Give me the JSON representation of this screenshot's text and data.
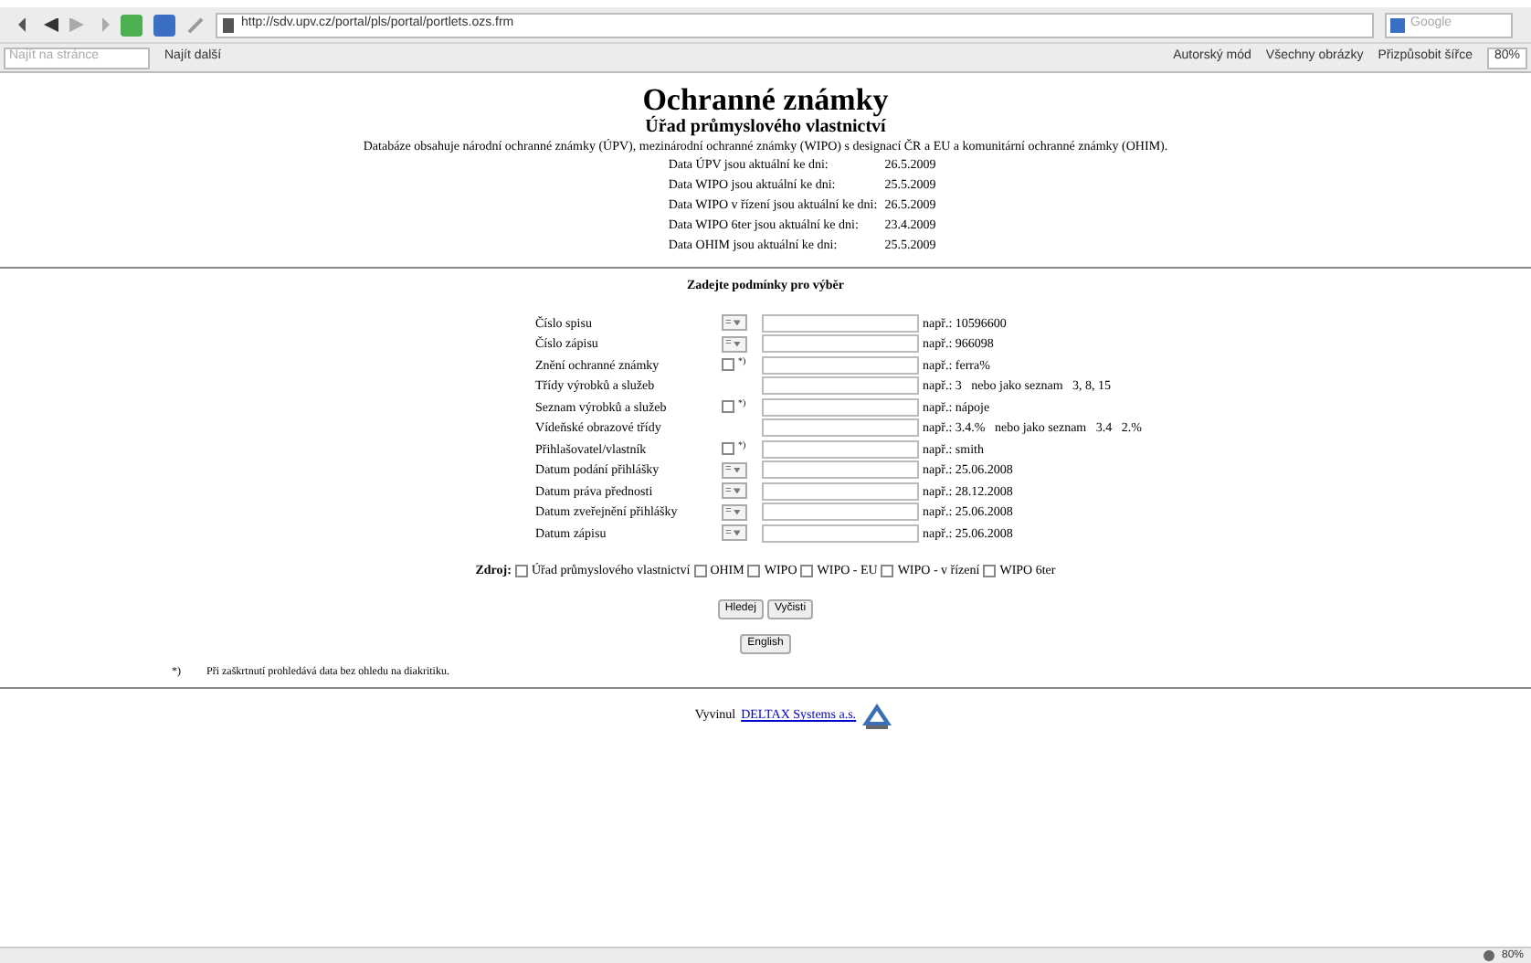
{
  "browser": {
    "url": "http://sdv.upv.cz/portal/pls/portal/portlets.ozs.frm",
    "search_placeholder": "Google",
    "find_placeholder": "Najít na stránce",
    "find_next": "Najít další",
    "toolbar_items": [
      "Autorský mód",
      "Všechny obrázky",
      "Přizpůsobit šířce"
    ],
    "zoom": "80%",
    "status_zoom": "80%"
  },
  "page": {
    "title": "Ochranné známky",
    "subtitle": "Úřad průmyslového vlastnictví",
    "description": "Databáze obsahuje národní ochranné známky (ÚPV), mezinárodní ochranné známky (WIPO) s designací ČR a EU a komunitární ochranné známky (OHIM).",
    "updates": [
      {
        "label": "Data ÚPV jsou aktuální ke dni:",
        "date": "26.5.2009"
      },
      {
        "label": "Data WIPO jsou aktuální ke dni:",
        "date": "25.5.2009"
      },
      {
        "label": "Data WIPO v řízení jsou aktuální ke dni:",
        "date": "26.5.2009"
      },
      {
        "label": "Data WIPO 6ter jsou aktuální ke dni:",
        "date": "23.4.2009"
      },
      {
        "label": "Data OHIM jsou aktuální ke dni:",
        "date": "25.5.2009"
      }
    ],
    "form_heading": "Zadejte podmínky pro výběr",
    "fields": [
      {
        "label": "Číslo spisu",
        "kind": "operator",
        "operator": "=",
        "hint": "např.: 10596600"
      },
      {
        "label": "Číslo zápisu",
        "kind": "operator",
        "operator": "=",
        "hint": "např.: 966098"
      },
      {
        "label": "Znění ochranné známky",
        "kind": "checkbox",
        "checked": false,
        "mark": "*)",
        "hint": "např.: ferra%"
      },
      {
        "label": "Třídy výrobků a služeb",
        "kind": "plain",
        "hint": "např.: 3   nebo jako seznam   3, 8, 15"
      },
      {
        "label": "Seznam výrobků a služeb",
        "kind": "checkbox",
        "checked": false,
        "mark": "*)",
        "hint": "např.: nápoje"
      },
      {
        "label": "Vídeňské obrazové třídy",
        "kind": "plain",
        "hint": "např.: 3.4.%   nebo jako seznam   3.4   2.%"
      },
      {
        "label": "Přihlašovatel/vlastník",
        "kind": "checkbox",
        "checked": false,
        "mark": "*)",
        "hint": "např.: smith"
      },
      {
        "label": "Datum podání přihlášky",
        "kind": "operator",
        "operator": "=",
        "hint": "např.: 25.06.2008"
      },
      {
        "label": "Datum práva přednosti",
        "kind": "operator",
        "operator": "=",
        "hint": "např.: 28.12.2008"
      },
      {
        "label": "Datum zveřejnění přihlášky",
        "kind": "operator",
        "operator": "=",
        "hint": "např.: 25.06.2008"
      },
      {
        "label": "Datum zápisu",
        "kind": "operator",
        "operator": "=",
        "hint": "např.: 25.06.2008"
      }
    ],
    "source_label": "Zdroj:",
    "sources": [
      {
        "label": "Úřad průmyslového vlastnictví",
        "checked": false
      },
      {
        "label": "OHIM",
        "checked": false
      },
      {
        "label": "WIPO",
        "checked": false
      },
      {
        "label": "WIPO - EU",
        "checked": false
      },
      {
        "label": "WIPO - v řízení",
        "checked": false
      },
      {
        "label": "WIPO 6ter",
        "checked": false
      }
    ],
    "buttons": [
      "Hledej",
      "Vyčisti"
    ],
    "language_button": "English",
    "footnote_mark": "*)",
    "footnote": "Při zaškrtnutí prohledává data bez ohledu na diakritiku.",
    "credit": "Vyvinul",
    "credit_link": "DELTAX Systems a.s."
  }
}
